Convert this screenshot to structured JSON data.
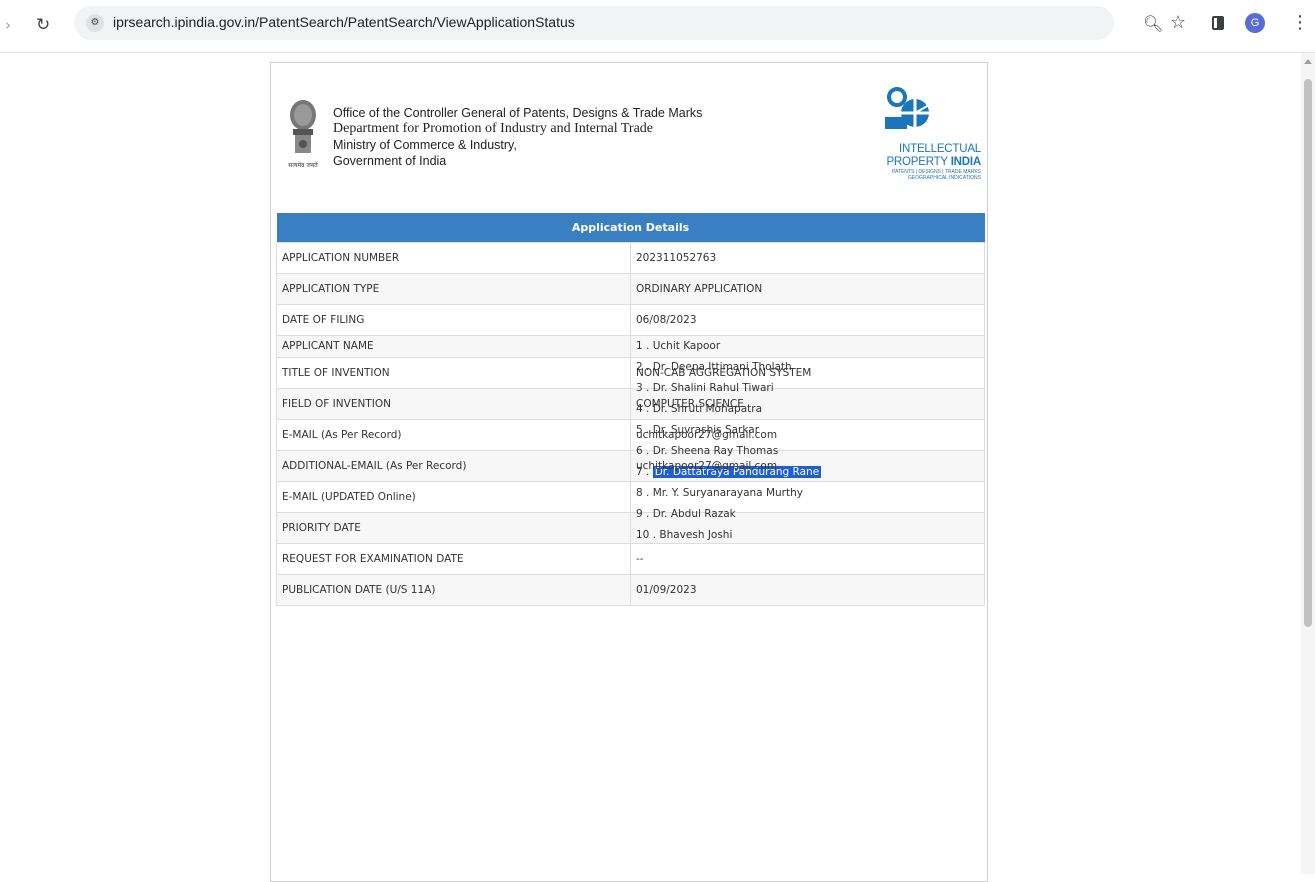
{
  "browser": {
    "url": "iprsearch.ipindia.gov.in/PatentSearch/PatentSearch/ViewApplicationStatus",
    "avatar_letter": "G"
  },
  "header": {
    "office_lines": [
      "Office of the Controller General of Patents, Designs & Trade Marks",
      "Department for Promotion of Industry and Internal Trade",
      "Ministry of Commerce & Industry,",
      "Government of India"
    ],
    "emblem_motto": "सत्यमेव जयते",
    "logo_line1": "INTELLECTUAL",
    "logo_line2_a": "PROPERTY ",
    "logo_line2_b": "INDIA",
    "logo_tag1": "PATENTS | DESIGNS | TRADE MARKS",
    "logo_tag2": "GEOGRAPHICAL INDICATIONS"
  },
  "table": {
    "title": "Application Details",
    "rows": [
      {
        "label": "APPLICATION NUMBER",
        "value": "202311052763"
      },
      {
        "label": "APPLICATION TYPE",
        "value": "ORDINARY APPLICATION"
      },
      {
        "label": "DATE OF FILING",
        "value": "06/08/2023"
      },
      {
        "label": "APPLICANT NAME",
        "value": ""
      },
      {
        "label": "TITLE OF INVENTION",
        "value": "NON-CAB AGGREGATION SYSTEM"
      },
      {
        "label": "FIELD OF INVENTION",
        "value": "COMPUTER SCIENCE"
      },
      {
        "label": "E-MAIL (As Per Record)",
        "value": "uchitkapoor27@gmail.com"
      },
      {
        "label": "ADDITIONAL-EMAIL (As Per Record)",
        "value": "uchitkapoor27@gmail.com"
      },
      {
        "label": "E-MAIL (UPDATED Online)",
        "value": ""
      },
      {
        "label": "PRIORITY DATE",
        "value": ""
      },
      {
        "label": "REQUEST FOR EXAMINATION DATE",
        "value": "--"
      },
      {
        "label": "PUBLICATION DATE (U/S 11A)",
        "value": "01/09/2023"
      }
    ],
    "applicants": [
      {
        "num": "1 .",
        "name": "Uchit Kapoor"
      },
      {
        "num": "2 .",
        "name": "Dr. Deepa Ittimani Tholath"
      },
      {
        "num": "3 .",
        "name": "Dr. Shalini Rahul Tiwari"
      },
      {
        "num": "4 .",
        "name": "Dr. Shruti Mohapatra"
      },
      {
        "num": "5 .",
        "name": "Dr. Suvrashis Sarkar"
      },
      {
        "num": "6 .",
        "name": "Dr. Sheena Ray Thomas"
      },
      {
        "num": "7 .",
        "name": "Dr. Dattatraya Pandurang Rane"
      },
      {
        "num": "8 .",
        "name": "Mr. Y. Suryanarayana Murthy"
      },
      {
        "num": "9 .",
        "name": "Dr. Abdul Razak"
      },
      {
        "num": "10 .",
        "name": "Bhavesh Joshi"
      }
    ],
    "selected_applicant_index": 6
  },
  "colors": {
    "header_blue": "#3a7fc1",
    "logo_blue": "#1b75bb",
    "selection": "#1f5fd1"
  }
}
